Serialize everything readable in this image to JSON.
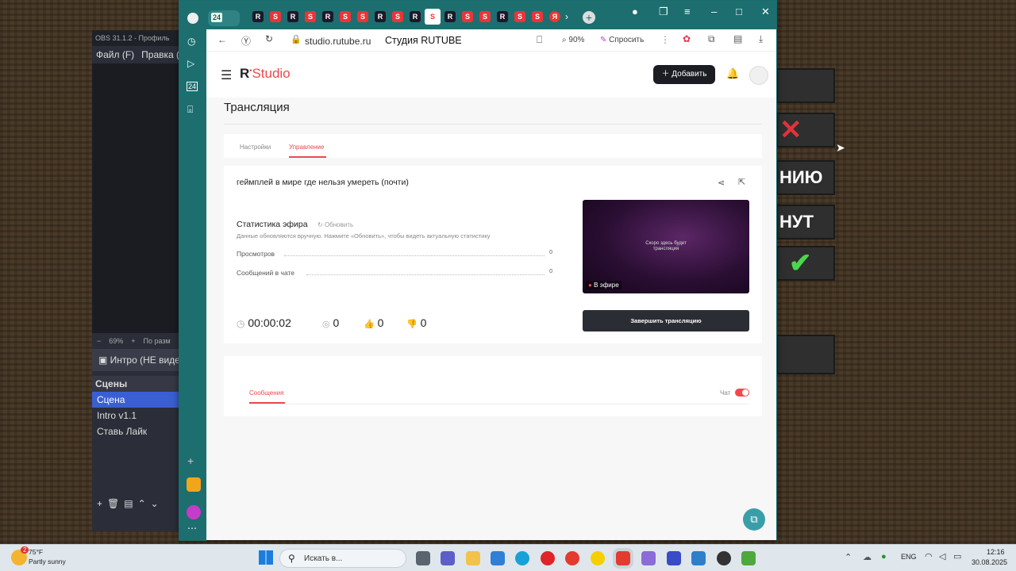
{
  "obs": {
    "title": "OBS 31.1.2 - Профиль",
    "menu_file": "Файл (F)",
    "menu_edit": "Правка (E",
    "zoom": "69%",
    "zoom_minus": "−",
    "zoom_plus": "+",
    "zoom_hint": "По разм",
    "source": "Интро (НЕ виде",
    "scenes_header": "Сцены",
    "scenes": [
      "Сцена",
      "Intro v1.1",
      "Ставь Лайк"
    ]
  },
  "game": {
    "btn2": "✕",
    "btn3": "НИЮ",
    "btn4": "НУТ",
    "btn5": "✔"
  },
  "browser": {
    "tab_counter": "24",
    "url": "studio.rutube.ru",
    "page_title": "Студия RUTUBE",
    "zoom": "90%",
    "ask_label": "Спросить",
    "sidebar_counter": "24"
  },
  "studio": {
    "logo_r": "R",
    "logo_text": "Studio",
    "add_label": "Добавить",
    "page_heading": "Трансляция",
    "tabs": [
      {
        "label": "Настройки"
      },
      {
        "label": "Управление"
      }
    ],
    "stream_title": "геймплей в мире где нельзя умереть (почти)",
    "stats_title": "Статистика эфира",
    "refresh_label": "Обновить",
    "stats_hint": "Данные обновляются вручную. Нажмите «Обновить», чтобы видеть актуальную статистику",
    "stats": [
      {
        "label": "Просмотров",
        "value": "0"
      },
      {
        "label": "Сообщений в чате",
        "value": "0"
      }
    ],
    "timer": "00:00:02",
    "viewers": "0",
    "likes": "0",
    "dislikes": "0",
    "preview_text": "Скоро здесь будет трансляция",
    "live_badge": "В эфире",
    "end_button": "Завершить трансляцию",
    "messages_tab": "Сообщения",
    "chat_label": "Чат"
  },
  "taskbar": {
    "temp": "75°F",
    "weather": "Partly sunny",
    "weather_badge": "2",
    "search": "Искать в...",
    "lang": "ENG",
    "time": "12:16",
    "date": "30.08.2025"
  },
  "colors": {
    "accent": "#f0484b",
    "browser_chrome": "#1d6e6f",
    "obs_selected": "#3a5fd4"
  }
}
